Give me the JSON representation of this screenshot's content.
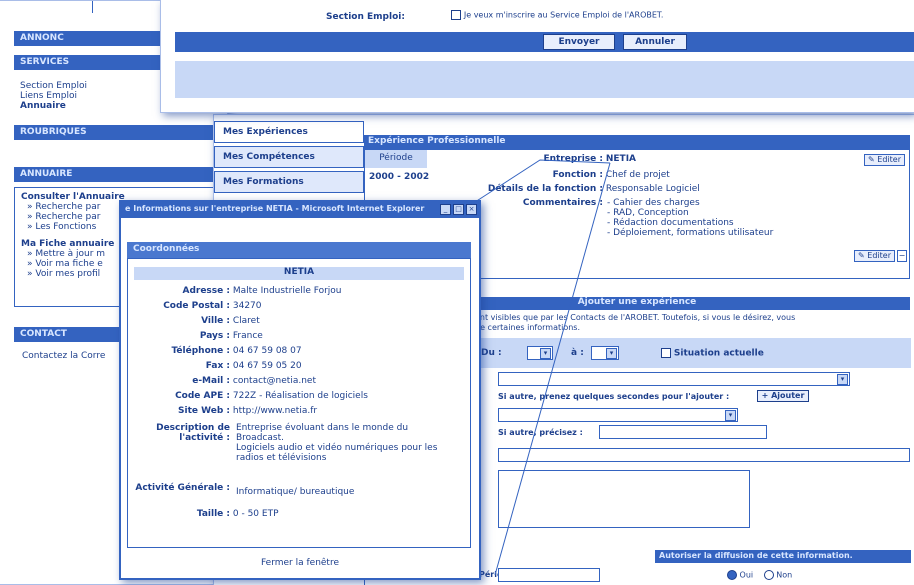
{
  "top_form": {
    "section_label": "Section Emploi:",
    "checkbox_text": "Je veux m'inscrire au Service Emploi de l'AROBET.",
    "submit_label": "Envoyer",
    "cancel_label": "Annuler"
  },
  "sidebar": {
    "section1_title": "ANNONC",
    "section1_subtitle": "SERVICES",
    "links": [
      "Section Emploi",
      "Liens Emploi",
      "Annuaire"
    ],
    "section2_title": "ROUBRIQUES",
    "section3_title": "ANNUAIRE",
    "annuaire_title": "Consulter l'Annuaire",
    "annuaire_links": [
      "» Recherche par",
      "» Recherche par",
      "» Les Fonctions"
    ],
    "fiche_title": "Ma Fiche annuaire",
    "fiche_links": [
      "» Mettre à jour m",
      "» Voir ma fiche e",
      "» Voir mes profil"
    ],
    "contact_title": "CONTACT",
    "contact_link": "Contactez la Corre"
  },
  "tabs": [
    "Mes Expériences",
    "Mes Compétences",
    "Mes Formations"
  ],
  "experience": {
    "header": "Expérience Professionnelle",
    "col_period": "Période",
    "period_value": "2000 - 2002",
    "entreprise_label": "Entreprise :",
    "entreprise_value": "NETIA",
    "fonction_label": "Fonction :",
    "fonction_value": "Chef de projet",
    "details_label": "Détails de la fonction :",
    "details_value": "Responsable Logiciel",
    "commentaires_label": "Commentaires :",
    "commentaires": [
      "- Cahier des charges",
      "- RAD, Conception",
      "- Rédaction documentations",
      "- Déploiement, formations utilisateur"
    ],
    "edit_label": "Editer",
    "edit_label2": "Editer"
  },
  "add_form": {
    "header": "Ajouter une expérience",
    "intro1": "ent visibles que par les Contacts de l'AROBET. Toutefois, si vous le désirez, vous",
    "intro2": "de certaines informations.",
    "du_label": "Du :",
    "au_label": "à :",
    "situation_label": "Situation actuelle",
    "si_autre_label": "Si autre, prenez quelques secondes pour l'ajouter :",
    "ajouter_label": "Ajouter",
    "si_autre_precisez": "Si autre, précisez :",
    "diffusion_label": "Autoriser la diffusion de cette information.",
    "oui_label": "Oui",
    "non_label": "Non",
    "bottom_label": "Période :"
  },
  "popup": {
    "title": "Informations sur l'entreprise NETIA - Microsoft Internet Explorer",
    "section": "Coordonnées",
    "company": "NETIA",
    "fields": [
      {
        "label": "Adresse :",
        "value": "Malte Industrielle Forjou"
      },
      {
        "label": "Code Postal :",
        "value": "34270"
      },
      {
        "label": "Ville :",
        "value": "Claret"
      },
      {
        "label": "Pays :",
        "value": "France"
      },
      {
        "label": "Téléphone :",
        "value": "04 67 59 08 07"
      },
      {
        "label": "Fax :",
        "value": "04 67 59 05 20"
      },
      {
        "label": "e-Mail :",
        "value": "contact@netia.net"
      },
      {
        "label": "Code APE :",
        "value": "722Z - Réalisation de logiciels"
      },
      {
        "label": "Site Web :",
        "value": "http://www.netia.fr"
      }
    ],
    "description_label": "Description de l'activité :",
    "description_lines": [
      "Entreprise évoluant dans le monde du",
      "Broadcast.",
      "Logiciels audio et vidéo numériques pour les",
      "radios et télévisions"
    ],
    "activite_label": "Activité Générale :",
    "activite_value": "Informatique/ bureautique",
    "taille_label": "Taille :",
    "taille_value": "0 - 50 ETP",
    "close_label": "Fermer la fenêtre"
  },
  "colors": {
    "primary": "#3463c0",
    "dark": "#1d3f8c",
    "light": "#c8d8f6"
  }
}
